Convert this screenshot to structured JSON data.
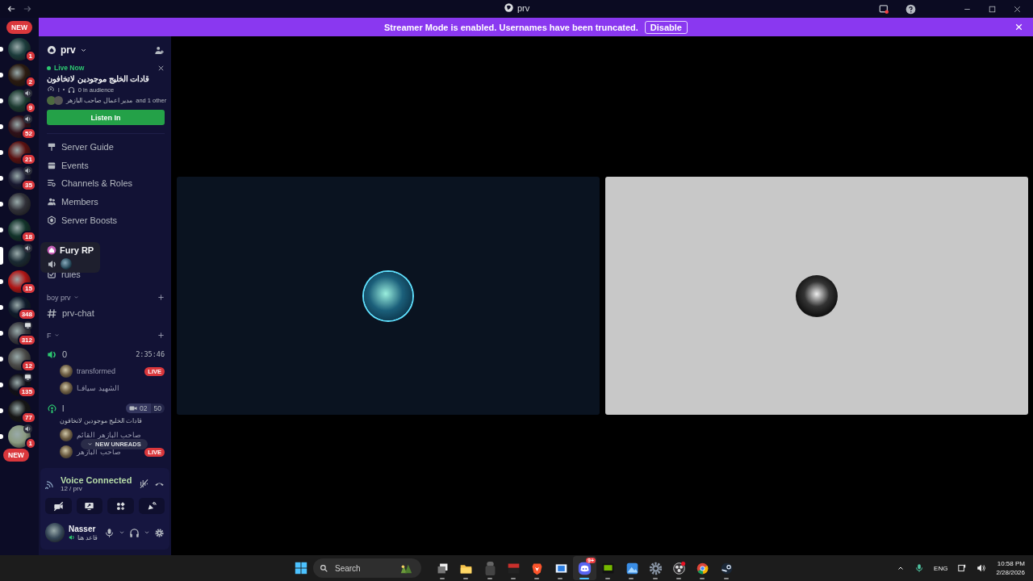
{
  "window": {
    "title": "prv"
  },
  "banner": {
    "message": "Streamer Mode is enabled. Usernames have been truncated.",
    "action": "Disable"
  },
  "rail": {
    "top_pill": "NEW",
    "bottom_pill": "NEW",
    "servers": [
      {
        "badge": "1",
        "in_voice": false,
        "streaming": false,
        "selected": false
      },
      {
        "badge": "2",
        "in_voice": false,
        "streaming": false,
        "selected": false
      },
      {
        "badge": "9",
        "in_voice": true,
        "streaming": false,
        "selected": false
      },
      {
        "badge": "52",
        "in_voice": true,
        "streaming": false,
        "selected": false
      },
      {
        "badge": "21",
        "in_voice": false,
        "streaming": false,
        "selected": false
      },
      {
        "badge": "35",
        "in_voice": true,
        "streaming": false,
        "selected": false
      },
      {
        "in_voice": false,
        "streaming": false,
        "selected": false
      },
      {
        "badge": "18",
        "in_voice": false,
        "streaming": false,
        "selected": false
      },
      {
        "in_voice": true,
        "streaming": false,
        "selected": true
      },
      {
        "badge": "15",
        "in_voice": false,
        "streaming": false,
        "selected": false
      },
      {
        "badge": "348",
        "in_voice": false,
        "streaming": false,
        "selected": false
      },
      {
        "badge": "312",
        "in_voice": false,
        "streaming": true,
        "selected": false
      },
      {
        "badge": "12",
        "in_voice": false,
        "streaming": false,
        "selected": false
      },
      {
        "badge": "135",
        "in_voice": false,
        "streaming": true,
        "selected": false
      },
      {
        "badge": "77",
        "in_voice": false,
        "streaming": false,
        "selected": false
      },
      {
        "badge": "1",
        "in_voice": true,
        "streaming": false,
        "selected": false
      }
    ]
  },
  "tooltip": {
    "server": "Fury RP"
  },
  "server": {
    "name": "prv"
  },
  "live_stage": {
    "status": "Live Now",
    "title": "قادات الخليج موجودين لاتخافون",
    "channel": "l",
    "audience": "0 in audience",
    "speakers": "مدير اعمال صاحب البازهر",
    "others": "and 1 other",
    "button": "Listen In"
  },
  "nav": [
    {
      "kind": "guide",
      "label": "Server Guide"
    },
    {
      "kind": "events",
      "label": "Events"
    },
    {
      "kind": "roles",
      "label": "Channels & Roles"
    },
    {
      "kind": "members",
      "label": "Members"
    },
    {
      "kind": "boosts",
      "label": "Server Boosts"
    }
  ],
  "rules": {
    "label": "rules"
  },
  "categories": [
    {
      "name": "boy prv",
      "channels": [
        {
          "kind": "text",
          "name": "prv-chat"
        }
      ]
    },
    {
      "name": "F",
      "channels": [
        {
          "kind": "voice",
          "name": "0",
          "timer": "2:35:46",
          "users": [
            {
              "name": "transformed",
              "badge": "LIVE"
            },
            {
              "name": "الشهيد سيافـا"
            }
          ]
        },
        {
          "kind": "stage",
          "name": "l",
          "video": "02",
          "limit": "50",
          "topic": "قادات الخليج موجودين لاتخافون",
          "users": [
            {
              "name": "صاحب البازهر القائم"
            },
            {
              "name": "صاحب البازهر",
              "badge": "LIVE"
            }
          ]
        }
      ]
    }
  ],
  "new_unreads": "NEW UNREADS",
  "voice": {
    "status": "Voice Connected",
    "channel": "12 / prv"
  },
  "user": {
    "name": "Nasser",
    "status": "قاعد هنا"
  },
  "taskbar": {
    "search": "Search",
    "apps": [
      {
        "kind": "taskview",
        "active": false
      },
      {
        "kind": "folder",
        "active": false
      },
      {
        "kind": "figure",
        "active": false
      },
      {
        "kind": "mixer",
        "active": false
      },
      {
        "kind": "shield",
        "active": false
      },
      {
        "kind": "window",
        "active": false
      },
      {
        "kind": "chat",
        "active": true,
        "badge": "9+"
      },
      {
        "kind": "gpu",
        "active": false
      },
      {
        "kind": "photos",
        "active": false
      },
      {
        "kind": "gear",
        "active": false
      },
      {
        "kind": "record",
        "active": false
      },
      {
        "kind": "browser",
        "active": false
      },
      {
        "kind": "store",
        "active": false
      }
    ],
    "language": "ENG",
    "time": "10:58 PM",
    "date": "2/28/2026"
  }
}
